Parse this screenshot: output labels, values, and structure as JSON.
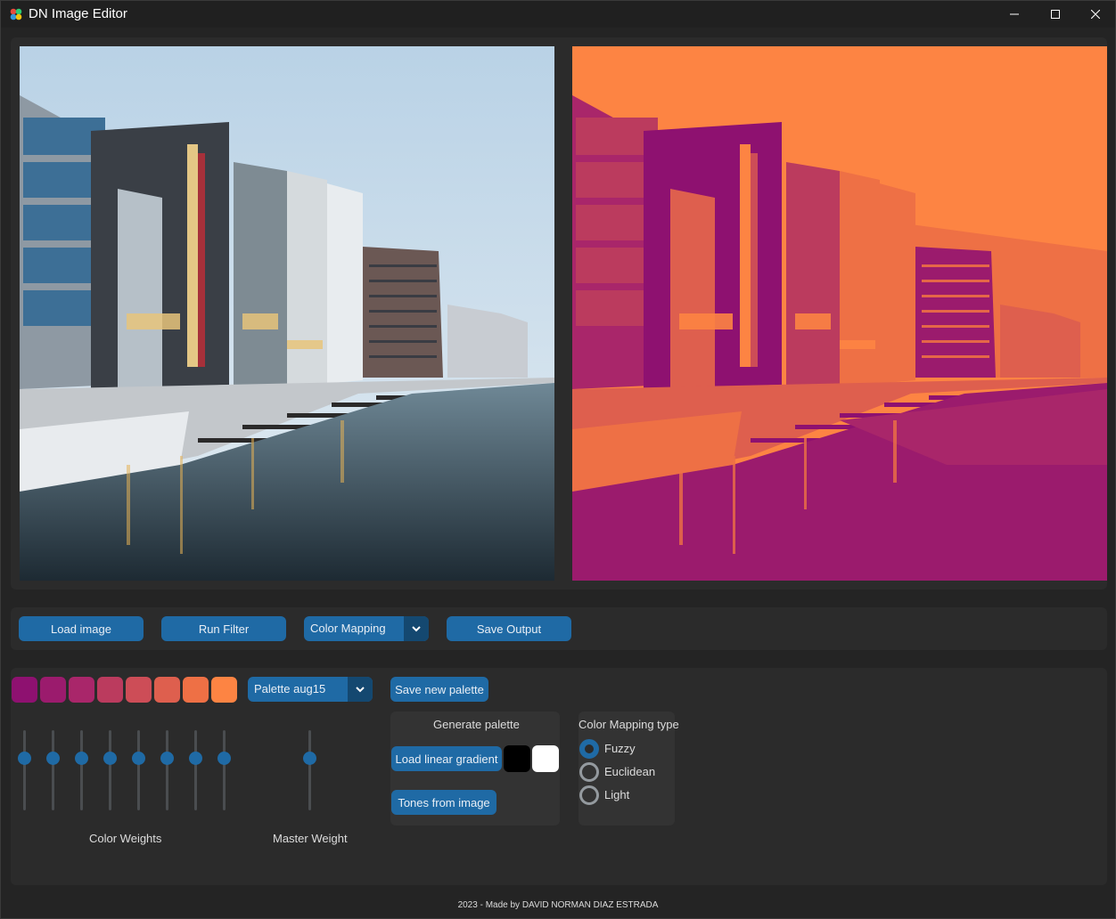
{
  "window": {
    "title": "DN Image Editor"
  },
  "toolbar": {
    "load_image": "Load image",
    "run_filter": "Run Filter",
    "filter_selected": "Color Mapping",
    "save_output": "Save Output"
  },
  "palette": {
    "swatches": [
      "#8e1170",
      "#9b1b6d",
      "#a9266a",
      "#bb3b5e",
      "#cd4d57",
      "#de5f4e",
      "#ee7045",
      "#fd8443"
    ],
    "selected_palette": "Palette aug15",
    "save_new_palette": "Save new palette",
    "color_weights_label": "Color Weights",
    "master_weight_label": "Master Weight"
  },
  "generate": {
    "title": "Generate palette",
    "load_gradient": "Load linear gradient",
    "gradient_start": "#000000",
    "gradient_end": "#ffffff",
    "tones_from_image": "Tones from image"
  },
  "mapping_type": {
    "title": "Color Mapping type",
    "options": [
      "Fuzzy",
      "Euclidean",
      "Light"
    ],
    "selected": "Fuzzy"
  },
  "footer": {
    "credit": "2023 - Made by DAVID NORMAN DIAZ ESTRADA"
  },
  "colors": {
    "accent": "#1f6aa5",
    "accent_dark": "#144870"
  }
}
